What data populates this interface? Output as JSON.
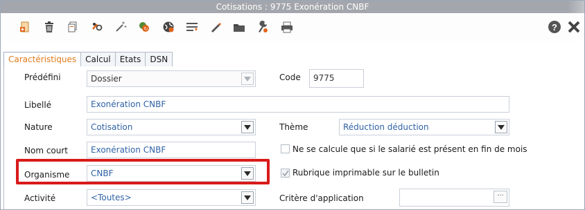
{
  "window": {
    "title": "Cotisations : 9775 Exonération  CNBF"
  },
  "toolbar": {
    "left_icons": [
      "new-document-icon",
      "delete-icon",
      "copy-icon",
      "link-icon",
      "wand-icon",
      "recalc-icon",
      "globe-icon",
      "list-icon",
      "pen-icon",
      "folder-icon",
      "tools-icon",
      "print-icon"
    ],
    "right_icons": [
      "help-icon",
      "close-icon"
    ]
  },
  "tabs": [
    "Caractéristiques",
    "Calcul",
    "Etats",
    "DSN"
  ],
  "form": {
    "predefini": {
      "label": "Prédéfini",
      "value": "Dossier"
    },
    "code": {
      "label": "Code",
      "value": "9775"
    },
    "libelle": {
      "label": "Libellé",
      "value": "Exonération  CNBF"
    },
    "nature": {
      "label": "Nature",
      "value": "Cotisation"
    },
    "theme": {
      "label": "Thème",
      "value": "Réduction déduction"
    },
    "nom_court": {
      "label": "Nom court",
      "value": "Exonération  CNBF"
    },
    "organisme": {
      "label": "Organisme",
      "value": "CNBF"
    },
    "activite": {
      "label": "Activité",
      "value": "<Toutes>"
    },
    "critere": {
      "label": "Critère d'application",
      "value": ""
    },
    "check_fin_mois": {
      "label": "Ne se calcule que si le salarié est présent en fin de mois",
      "checked": false
    },
    "check_imprimable": {
      "label": "Rubrique imprimable sur le bulletin",
      "checked": true
    }
  },
  "colors": {
    "highlight": "#d91a1a",
    "active_tab": "#e07a1a",
    "field_text": "#2f62a6"
  }
}
